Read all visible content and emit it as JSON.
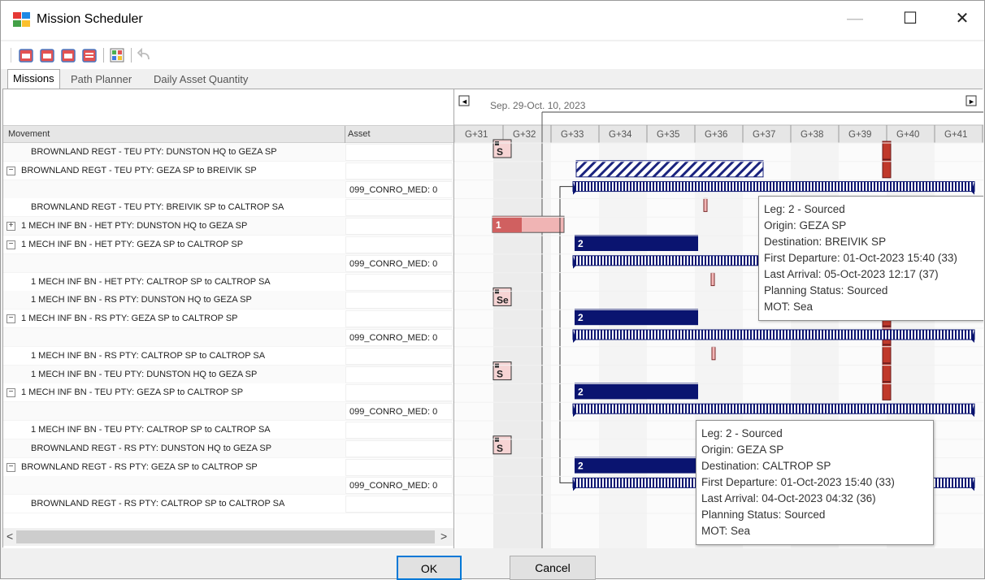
{
  "window": {
    "title": "Mission Scheduler",
    "minimize": "—",
    "maximize": "☐",
    "close": "✕"
  },
  "toolbar": {
    "buttons": [
      "calendar-red-1-icon",
      "calendar-red-2-icon",
      "calendar-red-3-icon",
      "calendar-red-4-icon",
      "grid-view-icon",
      "undo-icon"
    ]
  },
  "tabs": [
    "Missions",
    "Path Planner",
    "Daily Asset Quantity"
  ],
  "grid": {
    "columns": {
      "movement": "Movement",
      "asset": "Asset"
    },
    "rows": [
      {
        "expander": "",
        "movement": "BROWNLAND REGT - TEU PTY: DUNSTON HQ to GEZA SP",
        "asset": ""
      },
      {
        "expander": "−",
        "movement": "BROWNLAND REGT - TEU PTY: GEZA SP to BREIVIK SP",
        "asset": ""
      },
      {
        "expander": "",
        "movement": "",
        "asset": "099_CONRO_MED: 0"
      },
      {
        "expander": "",
        "movement": "BROWNLAND REGT - TEU PTY: BREIVIK SP to CALTROP SA",
        "asset": ""
      },
      {
        "expander": "+",
        "movement": "1 MECH INF BN - HET PTY: DUNSTON HQ to GEZA SP",
        "asset": ""
      },
      {
        "expander": "−",
        "movement": "1 MECH INF BN - HET PTY: GEZA SP to CALTROP SP",
        "asset": ""
      },
      {
        "expander": "",
        "movement": "",
        "asset": "099_CONRO_MED: 0"
      },
      {
        "expander": "",
        "movement": "1 MECH INF BN - HET PTY: CALTROP SP to CALTROP SA",
        "asset": ""
      },
      {
        "expander": "",
        "movement": "1 MECH INF BN - RS PTY: DUNSTON HQ to GEZA SP",
        "asset": ""
      },
      {
        "expander": "−",
        "movement": "1 MECH INF BN - RS PTY: GEZA SP to CALTROP SP",
        "asset": ""
      },
      {
        "expander": "",
        "movement": "",
        "asset": "099_CONRO_MED: 0"
      },
      {
        "expander": "",
        "movement": "1 MECH INF BN - RS PTY: CALTROP SP to CALTROP SA",
        "asset": ""
      },
      {
        "expander": "",
        "movement": "1 MECH INF BN - TEU PTY: DUNSTON HQ to GEZA SP",
        "asset": ""
      },
      {
        "expander": "−",
        "movement": "1 MECH INF BN - TEU PTY: GEZA SP to CALTROP SP",
        "asset": ""
      },
      {
        "expander": "",
        "movement": "",
        "asset": "099_CONRO_MED: 0"
      },
      {
        "expander": "",
        "movement": "1 MECH INF BN - TEU PTY: CALTROP SP to CALTROP SA",
        "asset": ""
      },
      {
        "expander": "",
        "movement": "BROWNLAND REGT - RS PTY: DUNSTON HQ to GEZA SP",
        "asset": ""
      },
      {
        "expander": "−",
        "movement": "BROWNLAND REGT - RS PTY: GEZA SP to CALTROP SP",
        "asset": ""
      },
      {
        "expander": "",
        "movement": "",
        "asset": "099_CONRO_MED: 0"
      },
      {
        "expander": "",
        "movement": "BROWNLAND REGT - RS PTY: CALTROP SP to CALTROP SA",
        "asset": ""
      }
    ],
    "scroll_left": "<",
    "scroll_right": ">"
  },
  "gantt": {
    "range_label": "Sep. 29-Oct. 10, 2023",
    "nav_left": "◄",
    "nav_right": "►",
    "days": [
      "G+31",
      "G+32",
      "G+33",
      "G+34",
      "G+35",
      "G+36",
      "G+37",
      "G+38",
      "G+39",
      "G+40",
      "G+41"
    ],
    "bar_labels": [
      "S",
      "1",
      "2",
      "Se",
      "2",
      "S",
      "2",
      "S",
      "2"
    ],
    "tooltips": [
      [
        "Leg: 2 - Sourced",
        "Origin: GEZA SP",
        "Destination: BREIVIK SP",
        "First Departure: 01-Oct-2023 15:40 (33)",
        "Last Arrival: 05-Oct-2023 12:17 (37)",
        "Planning Status: Sourced",
        "MOT: Sea"
      ],
      [
        "Leg: 2 - Sourced",
        "Origin: GEZA SP",
        "Destination: CALTROP SP",
        "First Departure: 01-Oct-2023 15:40 (33)",
        "Last Arrival: 04-Oct-2023 04:32 (36)",
        "Planning Status: Sourced",
        "MOT: Sea"
      ]
    ],
    "colors": {
      "navy": "#0a1470",
      "red": "#c0392b",
      "hatch": "#1a237e"
    }
  },
  "footer": {
    "ok": "OK",
    "cancel": "Cancel"
  }
}
